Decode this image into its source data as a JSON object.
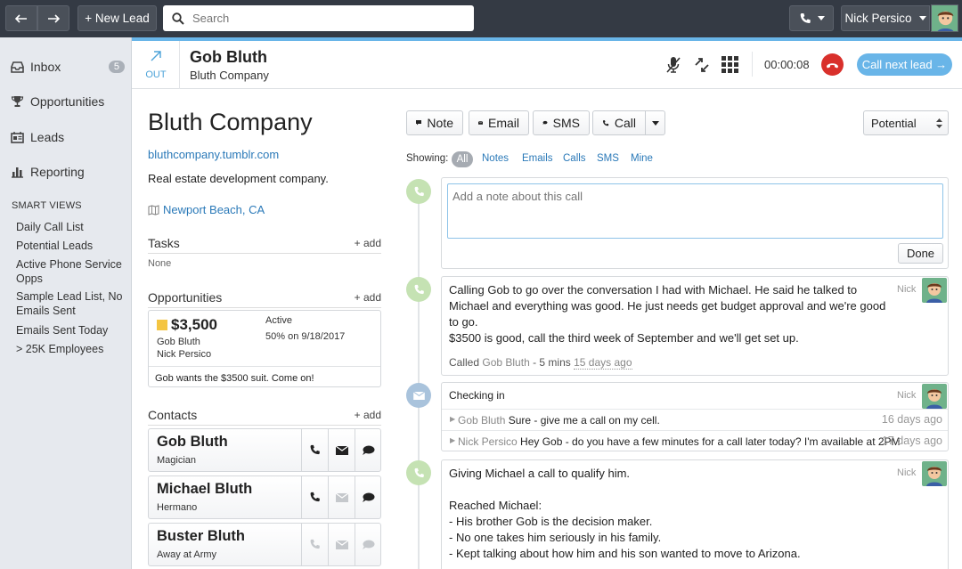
{
  "topbar": {
    "new_lead": "+ New Lead",
    "search_placeholder": "Search",
    "user_name": "Nick Persico"
  },
  "sidebar": {
    "items": [
      {
        "label": "Inbox",
        "badge": "5",
        "icon": "inbox-icon"
      },
      {
        "label": "Opportunities",
        "icon": "trophy-icon"
      },
      {
        "label": "Leads",
        "icon": "leads-icon"
      },
      {
        "label": "Reporting",
        "icon": "chart-icon"
      }
    ],
    "smart_views_title": "SMART VIEWS",
    "smart_views": [
      "Daily Call List",
      "Potential Leads",
      "Active Phone Service Opps",
      "Sample Lead List, No Emails Sent",
      "Emails Sent Today",
      "> 25K Employees"
    ]
  },
  "call_header": {
    "direction": "OUT",
    "contact_name": "Gob Bluth",
    "company": "Bluth Company",
    "timer": "00:00:08",
    "call_next": "Call next lead →"
  },
  "lead": {
    "title": "Bluth Company",
    "url": "bluthcompany.tumblr.com",
    "description": "Real estate development company.",
    "location": "Newport Beach, CA",
    "tasks_title": "Tasks",
    "tasks_add": "+ add",
    "tasks_empty": "None",
    "opps_title": "Opportunities",
    "opps_add": "+ add",
    "opportunity": {
      "value": "$3,500",
      "contact": "Gob Bluth",
      "owner": "Nick Persico",
      "status": "Active",
      "confidence": "50% on 9/18/2017",
      "note": "Gob wants the $3500 suit. Come on!",
      "color": "#f4c542"
    },
    "contacts_title": "Contacts",
    "contacts_add": "+ add",
    "contacts": [
      {
        "name": "Gob Bluth",
        "title": "Magician"
      },
      {
        "name": "Michael Bluth",
        "title": "Hermano"
      },
      {
        "name": "Buster Bluth",
        "title": "Away at Army"
      }
    ]
  },
  "actions": {
    "note": "Note",
    "email": "Email",
    "sms": "SMS",
    "call": "Call",
    "status_select": "Potential"
  },
  "filters": {
    "label": "Showing:",
    "items": [
      "All",
      "Notes",
      "Emails",
      "Calls",
      "SMS",
      "Mine"
    ],
    "active": "All"
  },
  "note_composer": {
    "placeholder": "Add a note about this call",
    "done": "Done"
  },
  "activities": {
    "call1": {
      "text1": "Calling Gob to go over the conversation I had with Michael. He said he talked to Michael and everything was good. He just needs get budget approval and we're good to go.",
      "text2": "$3500 is good, call the third week of September and we'll get set up.",
      "user": "Nick",
      "meta_prefix": "Called",
      "meta_contact": "Gob Bluth",
      "meta_duration": "- 5 mins",
      "meta_time": "15 days ago"
    },
    "email": {
      "subject": "Checking in",
      "user": "Nick",
      "messages": [
        {
          "from": "Gob Bluth",
          "text": "Sure - give me a call on my cell.",
          "time": "16 days ago"
        },
        {
          "from": "Nick Persico",
          "text": "Hey Gob - do you have a few minutes for a call later today? I'm available at 2PM",
          "time": "17 days ago"
        }
      ]
    },
    "call2": {
      "line1": "Giving Michael a call to qualify him.",
      "line2": "Reached Michael:",
      "bullets": [
        "- His brother Gob is the decision maker.",
        "- No one takes him seriously in his family.",
        "- Kept talking about how him and his son wanted to move to Arizona."
      ],
      "user": "Nick"
    }
  },
  "colors": {
    "topbar": "#343a44",
    "accent": "#69b5e8",
    "link": "#2a79b8",
    "hangup": "#d9302b",
    "call_icon_bg": "#c5e2b3",
    "email_icon_bg": "#a9c3dc"
  }
}
